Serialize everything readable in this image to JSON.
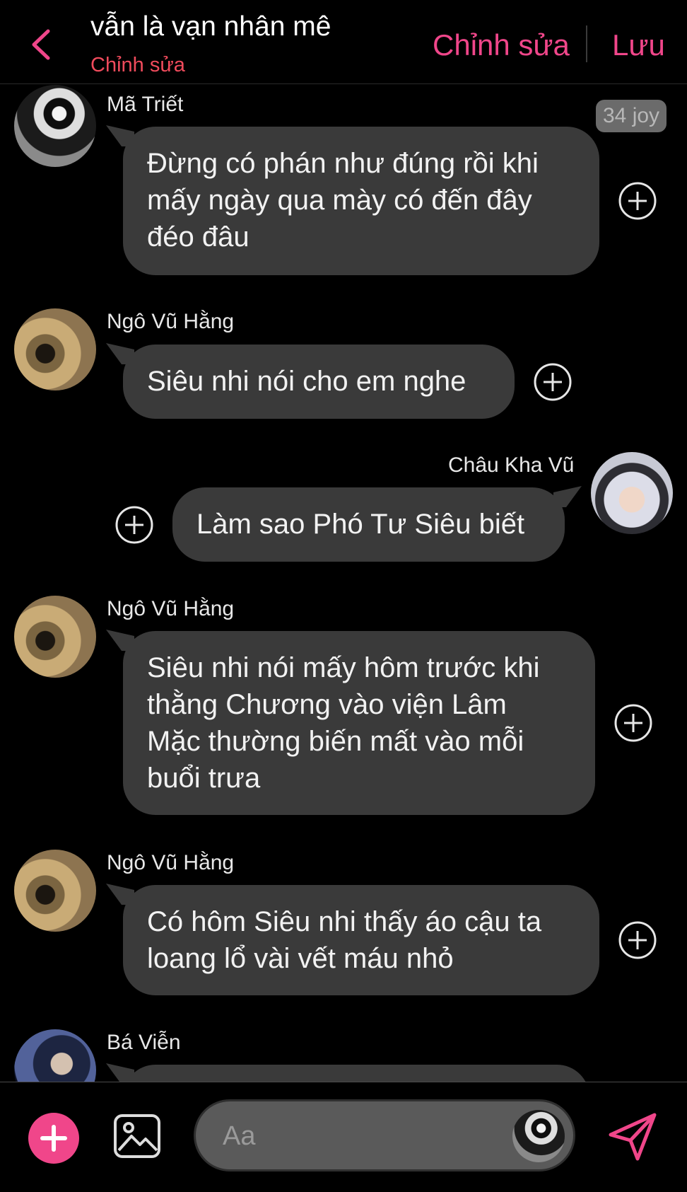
{
  "header": {
    "title": "vẫn là vạn nhân mê",
    "subtitle": "Chỉnh sửa",
    "edit_label": "Chỉnh sửa",
    "save_label": "Lưu"
  },
  "colors": {
    "accent": "#f0468a",
    "subtitle": "#f04b5c",
    "bubble": "#3a3a3a",
    "background": "#000000"
  },
  "messages": [
    {
      "sender": "Mã Triết",
      "side": "left",
      "avatar": "avatar-dark-jacket",
      "text": "Đừng có phán như đúng rồi khi\nmấy ngày qua mày có đến đây\nđéo đâu",
      "badge": "34 joy"
    },
    {
      "sender": "Ngô Vũ Hằng",
      "side": "left",
      "avatar": "avatar-sand",
      "text": "Siêu nhi nói cho em nghe"
    },
    {
      "sender": "Châu Kha Vũ",
      "side": "right",
      "avatar": "avatar-silver-hair",
      "text": "Làm sao Phó Tư Siêu biết"
    },
    {
      "sender": "Ngô Vũ Hằng",
      "side": "left",
      "avatar": "avatar-sand",
      "text": "Siêu nhi nói mấy hôm trước khi\nthằng Chương vào viện Lâm\nMặc thường biến mất vào mỗi\nbuổi trưa"
    },
    {
      "sender": "Ngô Vũ Hằng",
      "side": "left",
      "avatar": "avatar-sand",
      "text": "Có hôm Siêu nhi thấy áo cậu ta\nloang lổ vài vết máu nhỏ"
    },
    {
      "sender": "Bá Viễn",
      "side": "left",
      "avatar": "avatar-blue",
      "text": ""
    }
  ],
  "input": {
    "placeholder": "Aa"
  },
  "icons": {
    "back": "chevron-left-icon",
    "react": "plus-circle-icon",
    "add": "plus-icon",
    "image": "image-icon",
    "send": "send-icon"
  }
}
